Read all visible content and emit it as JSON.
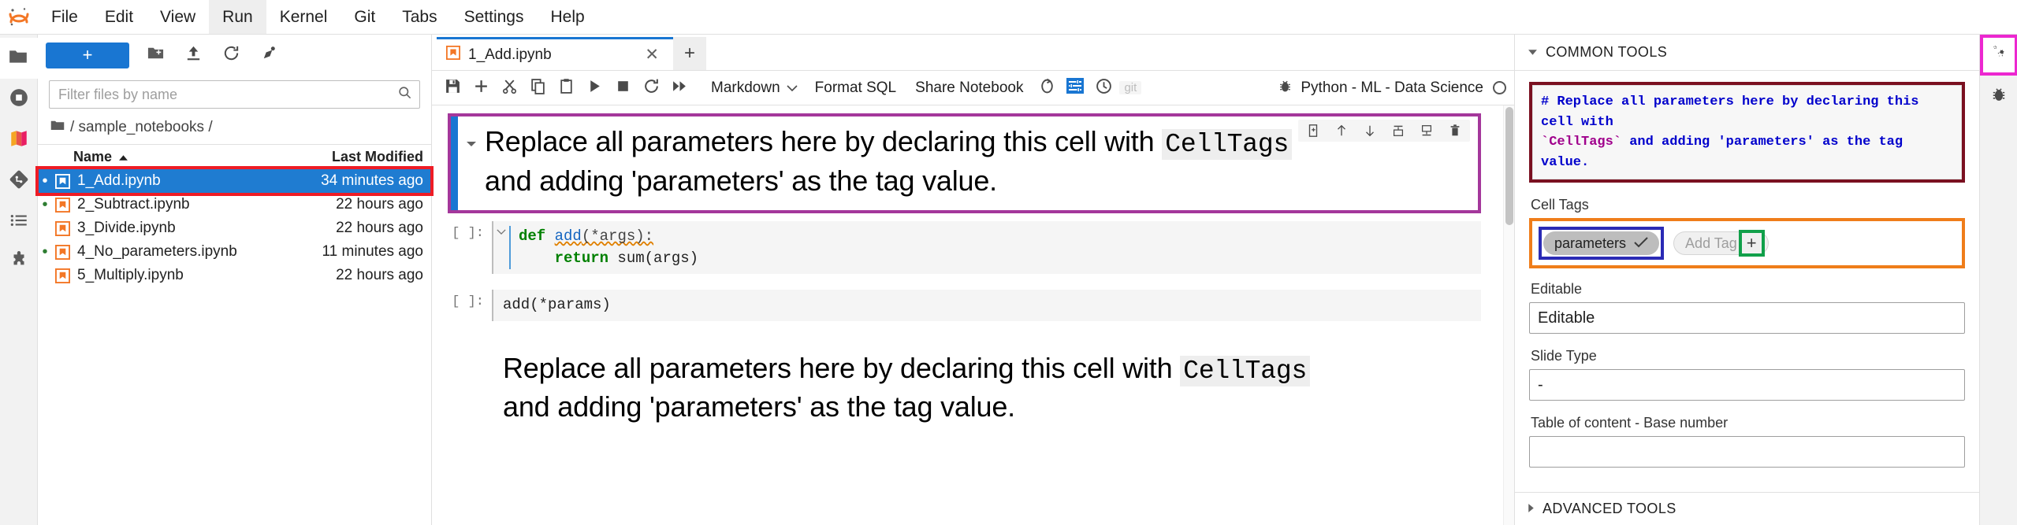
{
  "app": {
    "logo_icon": "jupyter-logo-icon"
  },
  "menubar": {
    "items": [
      {
        "label": "File",
        "active": false
      },
      {
        "label": "Edit",
        "active": false
      },
      {
        "label": "View",
        "active": false
      },
      {
        "label": "Run",
        "active": true
      },
      {
        "label": "Kernel",
        "active": false
      },
      {
        "label": "Git",
        "active": false
      },
      {
        "label": "Tabs",
        "active": false
      },
      {
        "label": "Settings",
        "active": false
      },
      {
        "label": "Help",
        "active": false
      }
    ]
  },
  "activitybar": {
    "items": [
      {
        "icon": "folder-icon",
        "name": "file-browser",
        "selected": true
      },
      {
        "icon": "running-terminals-icon",
        "name": "running-sessions",
        "selected": false
      },
      {
        "icon": "notebook-stack-icon",
        "name": "jupyterlab-books",
        "selected": false
      },
      {
        "icon": "git-icon",
        "name": "git-panel",
        "selected": false
      },
      {
        "icon": "table-of-contents-icon",
        "name": "table-of-contents",
        "selected": false
      },
      {
        "icon": "puzzle-icon",
        "name": "extension-manager",
        "selected": false
      }
    ]
  },
  "filebrowser": {
    "new_launcher_label": "+",
    "toolbar_icons": [
      "new-folder-icon",
      "upload-icon",
      "refresh-icon",
      "new-session-icon"
    ],
    "filter": {
      "placeholder": "Filter files by name",
      "value": "",
      "icon": "search-icon"
    },
    "breadcrumb": {
      "home_icon": "folder-icon",
      "path": "/ sample_notebooks /"
    },
    "columns": {
      "name": "Name",
      "last_modified": "Last Modified",
      "sort_icon": "caret-up-icon"
    },
    "files": [
      {
        "name": "1_Add.ipynb",
        "modified": "34 minutes ago",
        "icon": "notebook-icon",
        "status": "blue",
        "selected": true
      },
      {
        "name": "2_Subtract.ipynb",
        "modified": "22 hours ago",
        "icon": "notebook-icon",
        "status": "green",
        "selected": false
      },
      {
        "name": "3_Divide.ipynb",
        "modified": "22 hours ago",
        "icon": "notebook-icon",
        "status": "none",
        "selected": false
      },
      {
        "name": "4_No_parameters.ipynb",
        "modified": "11 minutes ago",
        "icon": "notebook-icon",
        "status": "green",
        "selected": false
      },
      {
        "name": "5_Multiply.ipynb",
        "modified": "22 hours ago",
        "icon": "notebook-icon",
        "status": "none",
        "selected": false
      }
    ]
  },
  "notebook": {
    "tab": {
      "title": "1_Add.ipynb",
      "icon": "notebook-icon",
      "close_icon": "close-icon"
    },
    "add_tab_label": "+",
    "toolbar": {
      "buttons": [
        {
          "name": "save-button",
          "icon": "save-icon"
        },
        {
          "name": "insert-cell-button",
          "icon": "plus-icon"
        },
        {
          "name": "cut-cell-button",
          "icon": "scissors-icon"
        },
        {
          "name": "copy-cell-button",
          "icon": "copy-icon"
        },
        {
          "name": "paste-cell-button",
          "icon": "paste-icon"
        },
        {
          "name": "run-cell-button",
          "icon": "play-icon"
        },
        {
          "name": "interrupt-kernel-button",
          "icon": "stop-icon"
        },
        {
          "name": "restart-kernel-button",
          "icon": "restart-icon"
        },
        {
          "name": "restart-run-all-button",
          "icon": "fast-forward-icon"
        }
      ],
      "cell_type": "Markdown",
      "cell_type_caret": "chevron-down-icon",
      "format_sql_label": "Format SQL",
      "share_notebook_label": "Share Notebook",
      "extra_icons": [
        {
          "name": "refresh-circle-icon",
          "icon": "refresh-circle-icon"
        },
        {
          "name": "cell-toolbar-toggle-icon",
          "icon": "sliders-icon",
          "active": true
        },
        {
          "name": "history-clock-icon",
          "icon": "clock-icon"
        }
      ],
      "git_label": "git",
      "debugger_icon": "bug-icon",
      "kernel_name": "Python - ML - Data Science",
      "kernel_status_icon": "kernel-idle-circle-icon"
    },
    "cells": [
      {
        "type": "markdown-active",
        "prompt": "",
        "text_before_code": "Replace all parameters here by declaring this cell with ",
        "inline_code": "CellTags",
        "text_after_code": "and adding 'parameters' as the tag value.",
        "cell_toolbar_icons": [
          "duplicate-cell-icon",
          "move-cell-up-icon",
          "move-cell-down-icon",
          "insert-cell-above-icon",
          "insert-cell-below-icon",
          "delete-cell-icon"
        ]
      },
      {
        "type": "code",
        "prompt": "[ ]:",
        "collapser": "chevron-down-icon",
        "line1_kw": "def",
        "line1_fn": "add",
        "line1_rest": "(*args):",
        "line2_kw": "return",
        "line2_rest": " sum(args)"
      },
      {
        "type": "code",
        "prompt": "[ ]:",
        "source": "add(*params)"
      },
      {
        "type": "markdown-rendered",
        "text_before_code": "Replace all parameters here by declaring this cell with ",
        "inline_code": "CellTags",
        "text_after_code": "and adding 'parameters' as the tag value."
      }
    ]
  },
  "rightpanel": {
    "header": {
      "caret": "caret-down-icon",
      "title": "COMMON TOOLS"
    },
    "md_source": {
      "line1": "# Replace all parameters here by declaring this cell with",
      "line2_tick_open": "`",
      "line2_code": "CellTags",
      "line2_tick_close": "`",
      "line2_rest": " and adding 'parameters' as the tag value."
    },
    "cell_tags": {
      "label": "Cell Tags",
      "tags": [
        {
          "label": "parameters",
          "check_icon": "check-icon",
          "active": true
        }
      ],
      "add_tag_label": "Add Tag",
      "add_tag_plus": "+"
    },
    "fields": [
      {
        "label": "Editable",
        "value": "Editable",
        "name": "editable-select"
      },
      {
        "label": "Slide Type",
        "value": "-",
        "name": "slide-type-select"
      },
      {
        "label": "Table of content - Base number",
        "value": "",
        "name": "toc-base-number-input"
      }
    ],
    "advanced": {
      "caret": "caret-right-icon",
      "title": "ADVANCED TOOLS"
    }
  },
  "rightbar": {
    "items": [
      {
        "icon": "property-inspector-gears-icon",
        "name": "property-inspector",
        "selected": true,
        "highlight": "#ec27d0"
      },
      {
        "icon": "bug-icon",
        "name": "debugger-panel",
        "selected": false
      }
    ]
  },
  "annotations": {
    "colors": {
      "selected_file": "#ee1c25",
      "active_cell": "#a4379b",
      "md_source": "#7a1020",
      "cell_tags_area": "#ef7d1a",
      "tag_chip": "#2a2ab5",
      "add_tag_plus": "#11a04a",
      "gear_button": "#ec27d0"
    }
  }
}
